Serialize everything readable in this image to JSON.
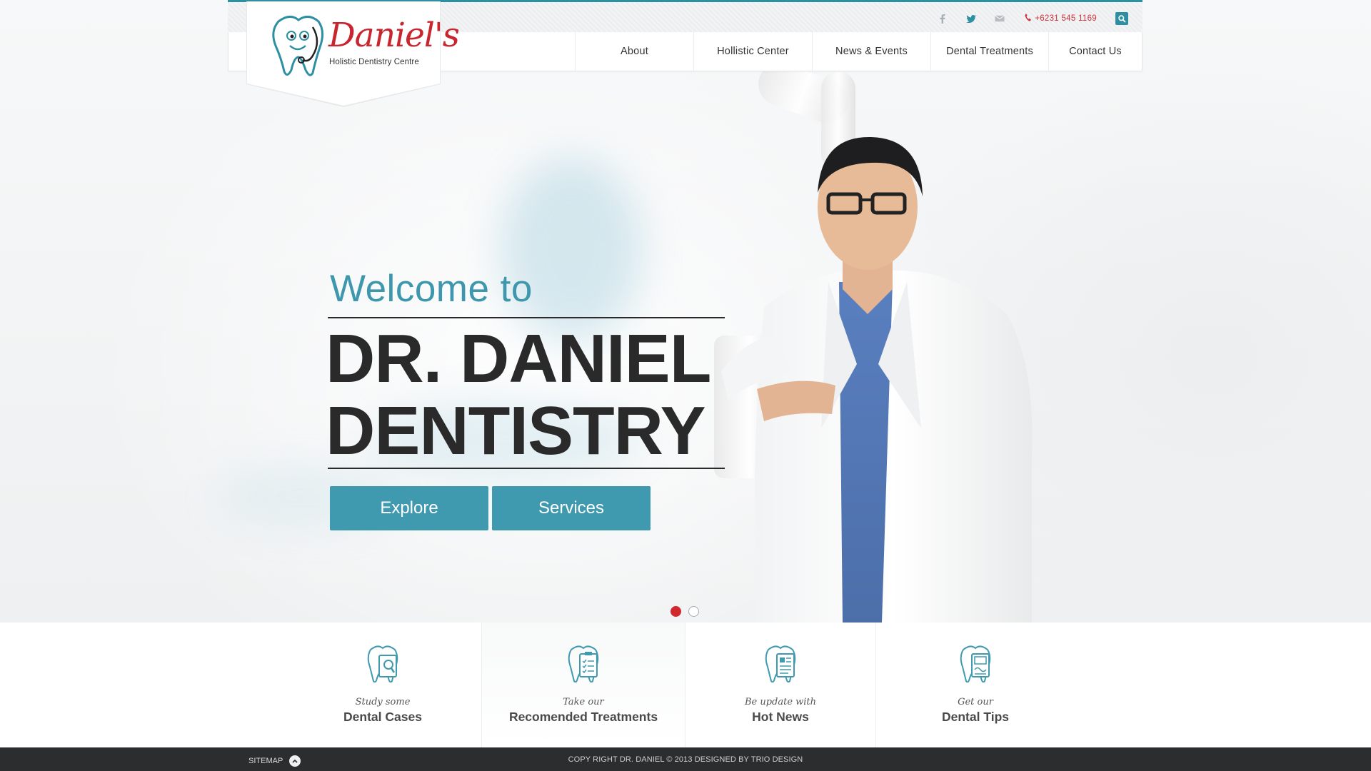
{
  "header": {
    "phone": "+6231 545 1169",
    "social": [
      "facebook-icon",
      "twitter-icon",
      "mail-icon"
    ]
  },
  "logo": {
    "name": "Daniel's",
    "tagline": "Holistic Dentistry Centre"
  },
  "nav": {
    "items": [
      {
        "label": "About"
      },
      {
        "label": "Hollistic Center"
      },
      {
        "label": "News & Events"
      },
      {
        "label": "Dental Treatments"
      },
      {
        "label": "Contact Us"
      }
    ]
  },
  "hero": {
    "welcome": "Welcome to",
    "line1": "DR. DANIEL",
    "line2": "DENTISTRY",
    "buttons": {
      "explore": "Explore",
      "services": "Services"
    },
    "active_slide": 1,
    "slide_count": 2
  },
  "features": [
    {
      "small": "Study some",
      "big": "Dental Cases",
      "icon": "tooth-magnifier-icon"
    },
    {
      "small": "Take our",
      "big": "Recomended Treatments",
      "icon": "tooth-clipboard-icon"
    },
    {
      "small": "Be update with",
      "big": "Hot News",
      "icon": "tooth-document-icon"
    },
    {
      "small": "Get our",
      "big": "Dental Tips",
      "icon": "tooth-tips-icon"
    }
  ],
  "footer": {
    "sitemap": "SITEMAP",
    "copyright": "COPY RIGHT DR. DANIEL © 2013 DESIGNED BY TRIO DESIGN"
  },
  "colors": {
    "accent": "#3f9ab0",
    "brand_red": "#c9252f",
    "footer_bg": "#2b2d2e"
  }
}
